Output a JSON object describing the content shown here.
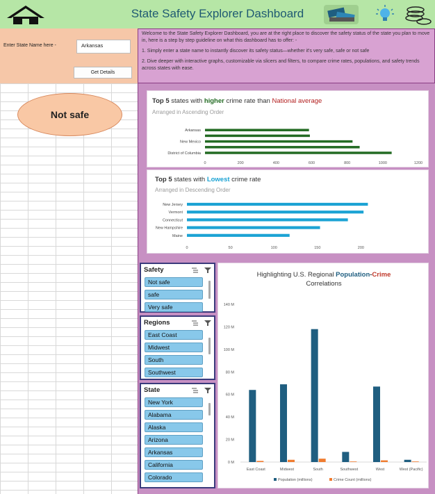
{
  "header": {
    "title": "State Safety Explorer Dashboard",
    "bg_color": "#b6e6a6",
    "icons": [
      "home-icon",
      "money-exchange-icon",
      "lightbulb-icon",
      "coins-icon"
    ]
  },
  "input_panel": {
    "state_label": "Enter State Name here -",
    "state_value": "Arkansas",
    "button_label": "Get Details"
  },
  "welcome": {
    "intro": "Welcome to the State Safety Explorer Dashboard, you are at the right place to discover the safety status of the state you plan to move in, here is a step by step guideline on what this dashboard has to offer: -",
    "step1": "1. Simply enter a state name to instantly discover its safety status—whether it's very safe, safe or not safe",
    "step2": "2. Dive deeper with interactive graphs, customizable via slicers and filters, to compare crime rates, populations,  and safety trends across states with ease."
  },
  "status": {
    "label": "Not safe"
  },
  "chart_top5_high": {
    "title_parts": [
      "Top 5",
      " states with ",
      "higher",
      " crime rate than ",
      "National average"
    ],
    "subtitle": "Arranged in Ascending Order"
  },
  "chart_top5_low": {
    "title_parts": [
      "Top 5",
      " states with ",
      "Lowest",
      " crime rate"
    ],
    "subtitle": "Arranged in Descending Order"
  },
  "chart_regional": {
    "title_parts": [
      "Highlighting U.S. Regional ",
      "Population",
      "-",
      "Crime",
      " Correlations"
    ]
  },
  "chart_data": [
    {
      "type": "bar",
      "orientation": "horizontal",
      "categories": [
        "District of Columbia",
        "",
        "New Mexico",
        "",
        "Arkansas"
      ],
      "values": [
        1050,
        870,
        830,
        590,
        585
      ],
      "xlim": [
        0,
        1200
      ],
      "xticks": [
        "0",
        "200",
        "400",
        "600",
        "800",
        "1000",
        "1200"
      ],
      "color": "#236b23"
    },
    {
      "type": "bar",
      "orientation": "horizontal",
      "categories": [
        "New Jersey",
        "Vermont",
        "Connecticut",
        "New Hampshire",
        "Maine"
      ],
      "values": [
        208,
        203,
        185,
        153,
        118
      ],
      "xlim": [
        0,
        250
      ],
      "xticks": [
        "0",
        "50",
        "100",
        "150",
        "200"
      ],
      "color": "#1ca3d4"
    },
    {
      "type": "bar",
      "categories": [
        "East Coast",
        "Midwest",
        "South",
        "Southwest",
        "West",
        "West (Pacific)"
      ],
      "series": [
        {
          "name": "Population (millions)",
          "values": [
            64,
            69,
            118,
            9,
            67,
            2
          ],
          "color": "#1f5e80"
        },
        {
          "name": "Crime Count (millions)",
          "values": [
            1,
            2,
            3,
            0.5,
            1.5,
            0.5
          ],
          "color": "#f07c30"
        }
      ],
      "ylim": [
        0,
        140
      ],
      "yticks": [
        "0 M",
        "20 M",
        "40 M",
        "60 M",
        "80 M",
        "100 M",
        "120 M",
        "140 M"
      ]
    }
  ],
  "slicers": {
    "safety": {
      "title": "Safety",
      "items": [
        "Not safe",
        "safe",
        "Very safe"
      ]
    },
    "regions": {
      "title": "Regions",
      "items": [
        "East Coast",
        "Midwest",
        "South",
        "Southwest"
      ]
    },
    "state": {
      "title": "State",
      "items": [
        "New York",
        "Alabama",
        "Alaska",
        "Arizona",
        "Arkansas",
        "California",
        "Colorado"
      ]
    }
  },
  "colors": {
    "higher": "#236b23",
    "national_average": "#b21e1e",
    "lowest": "#1ca3d4",
    "population": "#1f5e80",
    "crime": "#c0392b"
  }
}
